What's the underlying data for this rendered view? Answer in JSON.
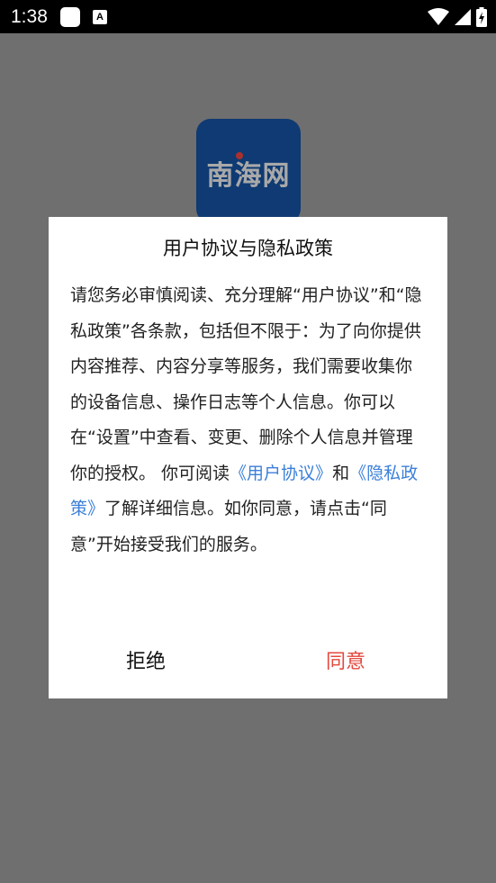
{
  "status_bar": {
    "time": "1:38",
    "icons": [
      "notification-square-icon",
      "keyboard-a-icon",
      "wifi-icon",
      "signal-icon",
      "battery-charging-icon"
    ]
  },
  "background": {
    "logo_text": "南海网"
  },
  "dialog": {
    "title": "用户协议与隐私政策",
    "body_part1": "请您务必审慎阅读、充分理解“用户协议”和“隐私政策”各条款，包括但不限于：为了向你提供内容推荐、内容分享等服务，我们需要收集你的设备信息、操作日志等个人信息。你可以在“设置”中查看、变更、删除个人信息并管理你的授权。 你可阅读",
    "link_user_agreement": "《用户协议》",
    "body_and": "和",
    "link_privacy_policy": "《隐私政策》",
    "body_part2": "了解详细信息。如你同意，请点击“同意”开始接受我们的服务。",
    "reject_label": "拒绝",
    "agree_label": "同意"
  },
  "colors": {
    "link": "#3b7fd8",
    "agree": "#e3483e",
    "overlay": "#6f6f6f",
    "logo_bg": "#0f3a73"
  }
}
